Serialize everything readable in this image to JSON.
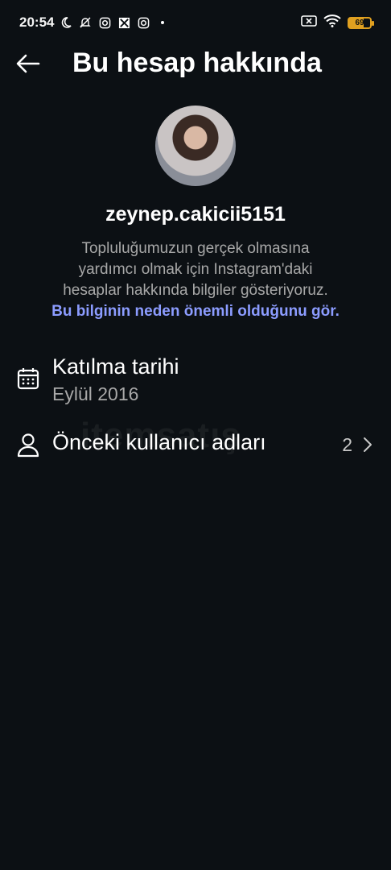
{
  "status_bar": {
    "time": "20:54",
    "battery_level": "69",
    "icons": [
      "moon-icon",
      "bell-off-icon",
      "instagram-icon",
      "app-icon",
      "instagram-icon",
      "dot-icon",
      "sim-off-icon",
      "wifi-icon",
      "battery-icon"
    ]
  },
  "header": {
    "title": "Bu hesap hakkında",
    "back_icon": "arrow-left-icon"
  },
  "profile": {
    "username": "zeynep.cakicii5151",
    "description_lines": [
      "Topluluğumuzun gerçek olmasına",
      "yardımcı olmak için Instagram'daki",
      "hesaplar hakkında bilgiler gösteriyoruz."
    ],
    "link_text": "Bu bilginin neden önemli olduğunu gör."
  },
  "rows": {
    "joined": {
      "icon": "calendar-icon",
      "title": "Katılma tarihi",
      "value": "Eylül 2016"
    },
    "former_usernames": {
      "icon": "person-icon",
      "title": "Önceki kullanıcı adları",
      "count": "2",
      "chevron": "chevron-right-icon"
    }
  },
  "watermark": "itemsatış",
  "colors": {
    "background": "#0c1014",
    "text_primary": "#ffffff",
    "text_secondary": "#a8a8a8",
    "link": "#8c9cff",
    "battery": "#e0a020"
  }
}
